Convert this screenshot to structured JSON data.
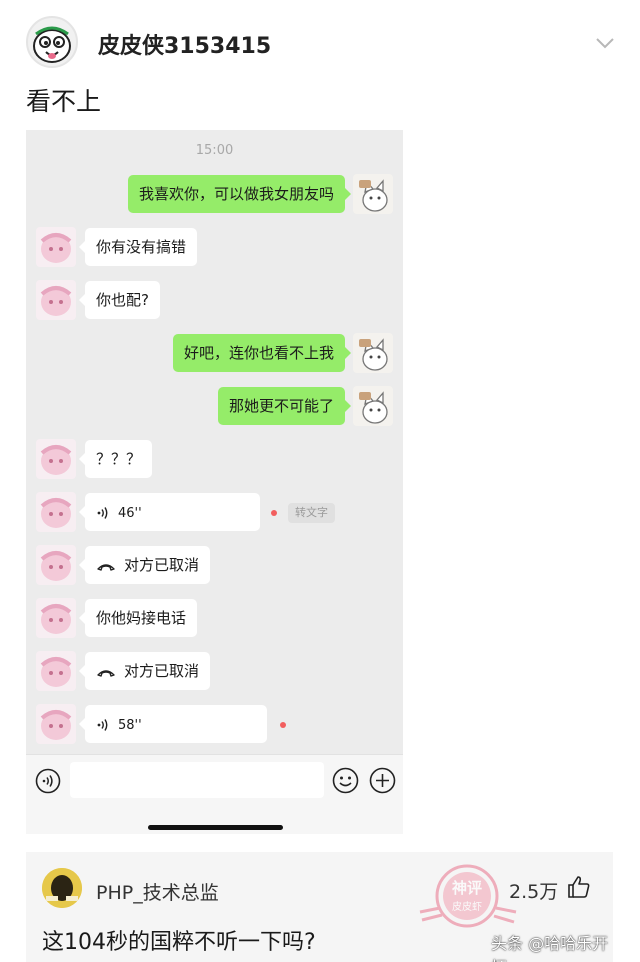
{
  "post": {
    "author": "皮皮侠3153415",
    "text": "看不上"
  },
  "chat": {
    "time": "15:00",
    "messages": [
      {
        "side": "right",
        "text": "我喜欢你，可以做我女朋友吗"
      },
      {
        "side": "left",
        "text": "你有没有搞错"
      },
      {
        "side": "left",
        "text": "你也配?"
      },
      {
        "side": "right",
        "text": "好吧，连你也看不上我"
      },
      {
        "side": "right",
        "text": "那她更不可能了"
      },
      {
        "side": "left",
        "text": "？？？"
      },
      {
        "side": "left",
        "type": "voice",
        "duration": "46''",
        "unread": true,
        "convert_label": "转文字"
      },
      {
        "side": "left",
        "type": "call",
        "text": "对方已取消"
      },
      {
        "side": "left",
        "text": "你他妈接电话"
      },
      {
        "side": "left",
        "type": "call",
        "text": "对方已取消"
      },
      {
        "side": "left",
        "type": "voice",
        "duration": "58''",
        "unread": true
      }
    ],
    "colors": {
      "sent_bubble": "#95ec69",
      "received_bubble": "#ffffff",
      "background": "#ececec"
    }
  },
  "comment": {
    "user": "PHP_技术总监",
    "likes": "2.5万",
    "text": "这104秒的国粹不听一下吗?",
    "stamp_top": "神评",
    "stamp_bottom": "皮皮虾"
  },
  "watermark": "头条 @哈哈乐开怀",
  "icons": [
    "chevron-down-icon",
    "voice-wave-icon",
    "phone-hangup-icon",
    "microphone-icon",
    "emoji-icon",
    "plus-icon",
    "thumbs-up-icon"
  ]
}
